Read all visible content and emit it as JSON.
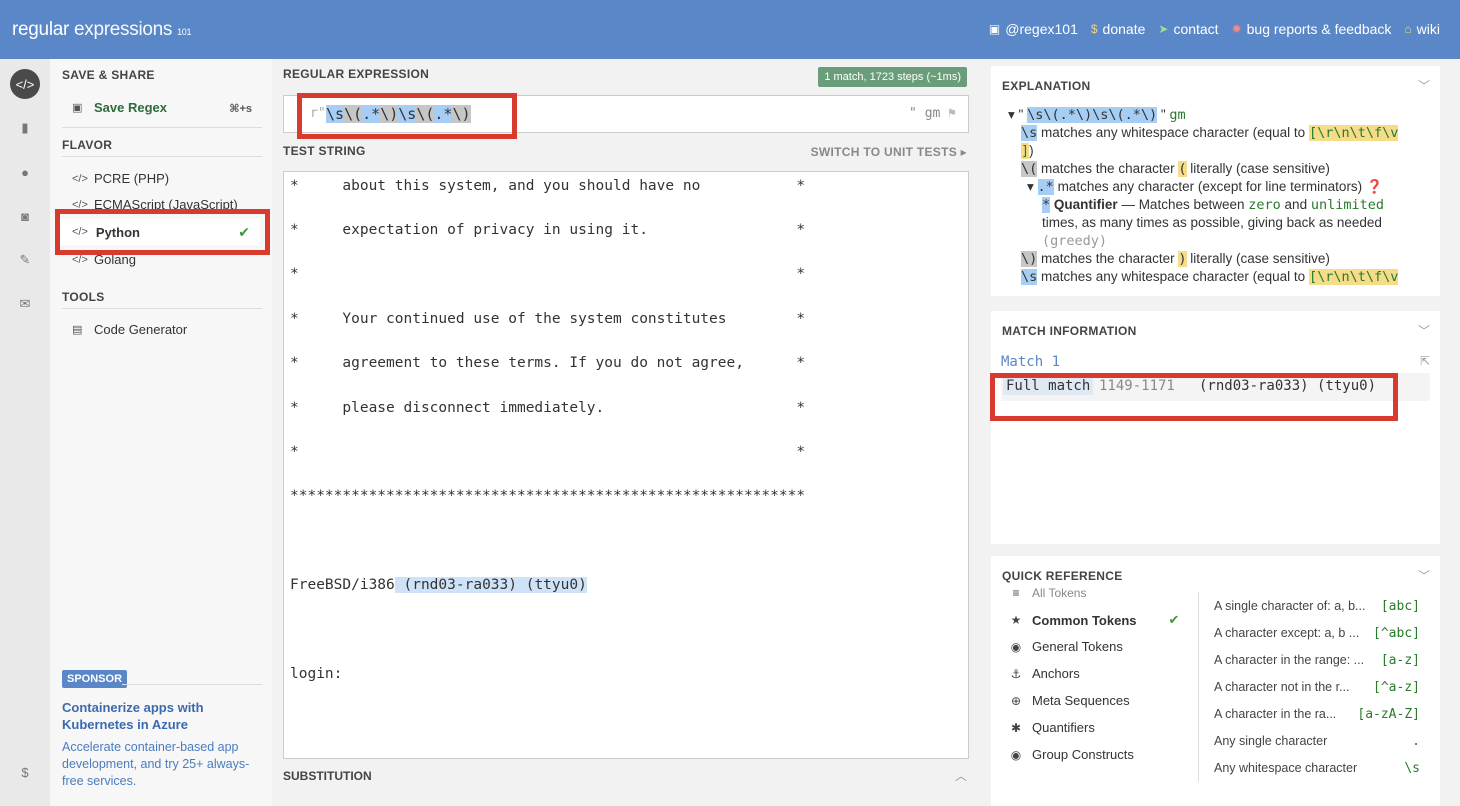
{
  "header": {
    "logo_main": "regular",
    "logo_sub": " expressions",
    "logo_ver": "101",
    "links": [
      {
        "icon": "twitter-icon",
        "label": "@regex101"
      },
      {
        "icon": "dollar-icon",
        "label": "donate"
      },
      {
        "icon": "paper-plane-icon",
        "label": "contact"
      },
      {
        "icon": "bug-icon",
        "label": "bug reports & feedback"
      },
      {
        "icon": "bank-icon",
        "label": "wiki"
      }
    ]
  },
  "left_panel": {
    "save_share_title": "SAVE & SHARE",
    "save_regex": "Save Regex",
    "save_shortcut": "⌘+s",
    "flavor_title": "FLAVOR",
    "flavors": [
      "PCRE (PHP)",
      "ECMAScript (JavaScript)",
      "Python",
      "Golang"
    ],
    "selected_flavor": "Python",
    "tools_title": "TOOLS",
    "code_generator": "Code Generator",
    "sponsor_badge": "SPONSOR",
    "sponsor_title": "Containerize apps with Kubernetes in Azure",
    "sponsor_desc": "Accelerate container-based app development, and try 25+ always-free services."
  },
  "regex": {
    "label": "REGULAR EXPRESSION",
    "match_info": "1 match, 1723 steps (~1ms)",
    "open_delim": "r\"",
    "tokens": [
      "\\s",
      "\\(",
      ".*",
      "\\)",
      "\\s",
      "\\(",
      ".*",
      "\\)"
    ],
    "close_delim": "\"",
    "flags": "gm"
  },
  "test": {
    "label": "TEST STRING",
    "switch_label": "SWITCH TO UNIT TESTS",
    "lines": [
      "*     about this system, and you should have no           *",
      "*     expectation of privacy in using it.                 *",
      "*                                                         *",
      "*     Your continued use of the system constitutes        *",
      "*     agreement to these terms. If you do not agree,      *",
      "*     please disconnect immediately.                      *",
      "*                                                         *",
      "***********************************************************",
      "",
      "",
      "FreeBSD/i386",
      "",
      "login:"
    ],
    "match_text": " (rnd03-ra033) (ttyu0)"
  },
  "substitution_label": "SUBSTITUTION",
  "explanation": {
    "title": "EXPLANATION",
    "regex_display": "\\s\\(.*\\)\\s\\(.*\\)",
    "flags": "gm",
    "rows": [
      {
        "token": "\\s",
        "text": "matches any whitespace character (equal to",
        "extra": "[\\r\\n\\t\\f\\v"
      },
      {
        "token": "]",
        "text": ")"
      },
      {
        "token": "\\(",
        "text": "matches the character",
        "char": "(",
        "tail": "literally (case sensitive)"
      },
      {
        "token": ".*",
        "text": "matches any character (except for line terminators)"
      },
      {
        "token": "*",
        "bold": "Quantifier",
        "text": "— Matches between",
        "zero": "zero",
        "and": "and",
        "unlimited": "unlimited"
      },
      {
        "text": "times, as many times as possible, giving back as needed"
      },
      {
        "text": "(greedy)"
      },
      {
        "token": "\\)",
        "text": "matches the character",
        "char": ")",
        "tail": "literally (case sensitive)"
      },
      {
        "token": "\\s",
        "text": "matches any whitespace character (equal to",
        "extra": "[\\r\\n\\t\\f\\v"
      }
    ]
  },
  "match_information": {
    "title": "MATCH INFORMATION",
    "match_label": "Match 1",
    "full_match": "Full match",
    "range": "1149-1171",
    "value": " (rnd03-ra033) (ttyu0)"
  },
  "quick_reference": {
    "title": "QUICK REFERENCE",
    "cut_item": "All Tokens",
    "categories": [
      {
        "icon": "star-icon",
        "label": "Common Tokens",
        "selected": true
      },
      {
        "icon": "target-icon",
        "label": "General Tokens"
      },
      {
        "icon": "anchor-icon",
        "label": "Anchors"
      },
      {
        "icon": "lifebuoy-icon",
        "label": "Meta Sequences"
      },
      {
        "icon": "asterisk-icon",
        "label": "Quantifiers"
      },
      {
        "icon": "target-icon",
        "label": "Group Constructs"
      }
    ],
    "entries": [
      {
        "desc": "A single character of: a, b...",
        "token": "[abc]"
      },
      {
        "desc": "A character except: a, b ...",
        "token": "[^abc]"
      },
      {
        "desc": "A character in the range: ...",
        "token": "[a-z]"
      },
      {
        "desc": "A character not in the r...",
        "token": "[^a-z]"
      },
      {
        "desc": "A character in the ra...",
        "token": "[a-zA-Z]"
      },
      {
        "desc": "Any single character",
        "token": "."
      },
      {
        "desc": "Any whitespace character",
        "token": "\\s"
      }
    ]
  }
}
